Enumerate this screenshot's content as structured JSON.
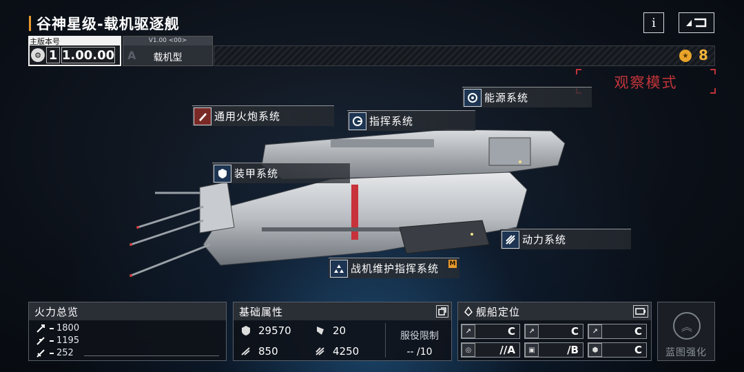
{
  "header": {
    "title": "谷神星级-载机驱逐舰",
    "info_label": "i",
    "back_icon": "back-arrow-icon"
  },
  "version": {
    "main_label": "主版本号",
    "index": "1",
    "number": "1.00.00",
    "small_version": "V1.00 <00>",
    "grade_letter": "A",
    "type": "载机型"
  },
  "currency": {
    "icon": "coin-icon",
    "value": "8"
  },
  "observe_mode": "观察模式",
  "systems": [
    {
      "label": "通用火炮系统",
      "icon": "cannon-icon",
      "accent": "#7a2a26"
    },
    {
      "label": "能源系统",
      "icon": "energy-icon",
      "accent": "#1d3552"
    },
    {
      "label": "指挥系统",
      "icon": "command-icon",
      "accent": "#1d3552"
    },
    {
      "label": "装甲系统",
      "icon": "armor-icon",
      "accent": "#1d3552"
    },
    {
      "label": "动力系统",
      "icon": "propulsion-icon",
      "accent": "#1d3552"
    },
    {
      "label": "战机维护指挥系统",
      "icon": "hangar-icon",
      "accent": "#1d3552",
      "badge": "M"
    }
  ],
  "firepower": {
    "title": "火力总览",
    "rows": [
      {
        "icon": "anti-ship-icon",
        "value": "1800"
      },
      {
        "icon": "anti-air-icon",
        "value": "1195"
      },
      {
        "icon": "siege-icon",
        "value": "252"
      }
    ]
  },
  "base_stats": {
    "title": "基础属性",
    "hp": "29570",
    "armor": "20",
    "speed": "850",
    "warp": "4250",
    "service_label": "服役限制",
    "service_value": "-- /10"
  },
  "positioning": {
    "title": "舰船定位",
    "cells": [
      "C",
      "C",
      "C",
      "//A",
      "/B",
      "C"
    ]
  },
  "enhance": {
    "label": "蓝图强化"
  },
  "colors": {
    "accent_orange": "#e89a2c",
    "observe_red": "#c2343a",
    "coin_gold": "#f2b23a"
  }
}
